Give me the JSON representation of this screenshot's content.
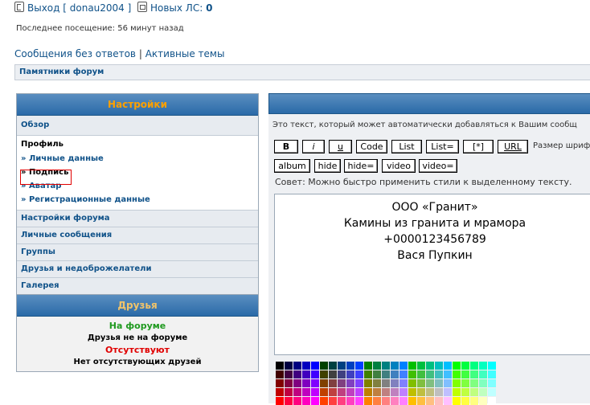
{
  "header": {
    "logout_label": "Выход [ donau2004 ]",
    "pm_label": "Новых ЛС:",
    "pm_count": "0",
    "last_visit": "Последнее посещение: 56 минут назад",
    "link_unanswered": "Сообщения без ответов",
    "link_separator": "|",
    "link_active": "Активные темы",
    "breadcrumb": "Памятники форум"
  },
  "settings": {
    "title": "Настройки",
    "overview": "Обзор",
    "profile_title": "Профиль",
    "profile_items": [
      "» Личные данные",
      "» Подпись",
      "» Аватар",
      "» Регистрационные данные"
    ],
    "items": [
      "Настройки форума",
      "Личные сообщения",
      "Группы",
      "Друзья и недоброжелатели",
      "Галерея"
    ]
  },
  "friends": {
    "title": "Друзья",
    "online_label": "На форуме",
    "online_text": "Друзья не на форуме",
    "offline_label": "Отсутствуют",
    "offline_text": "Нет отсутствующих друзей",
    "colors": {
      "online": "#1f9a1f",
      "offline": "#e00000"
    }
  },
  "editor": {
    "intro": "Это текст, который может автоматически добавляться к Вашим сообщ",
    "buttons_row1": [
      "B",
      "i",
      "u",
      "Code",
      "List",
      "List=",
      "[*]",
      "URL"
    ],
    "font_size_label": "Размер шриф",
    "buttons_row2": [
      "album",
      "hide",
      "hide=",
      "video",
      "video="
    ],
    "tip": "Совет: Можно быстро применить стили к выделенному тексту.",
    "content_lines": [
      "ООО «Гранит»",
      "Камины из гранита и мрамора",
      "+0000123456789",
      "Вася Пупкин"
    ]
  },
  "colors": {
    "accent": "#105289",
    "panel_header": "#2a6aa8",
    "settings_title": "#fda000",
    "highlight_border": "#e00000"
  }
}
